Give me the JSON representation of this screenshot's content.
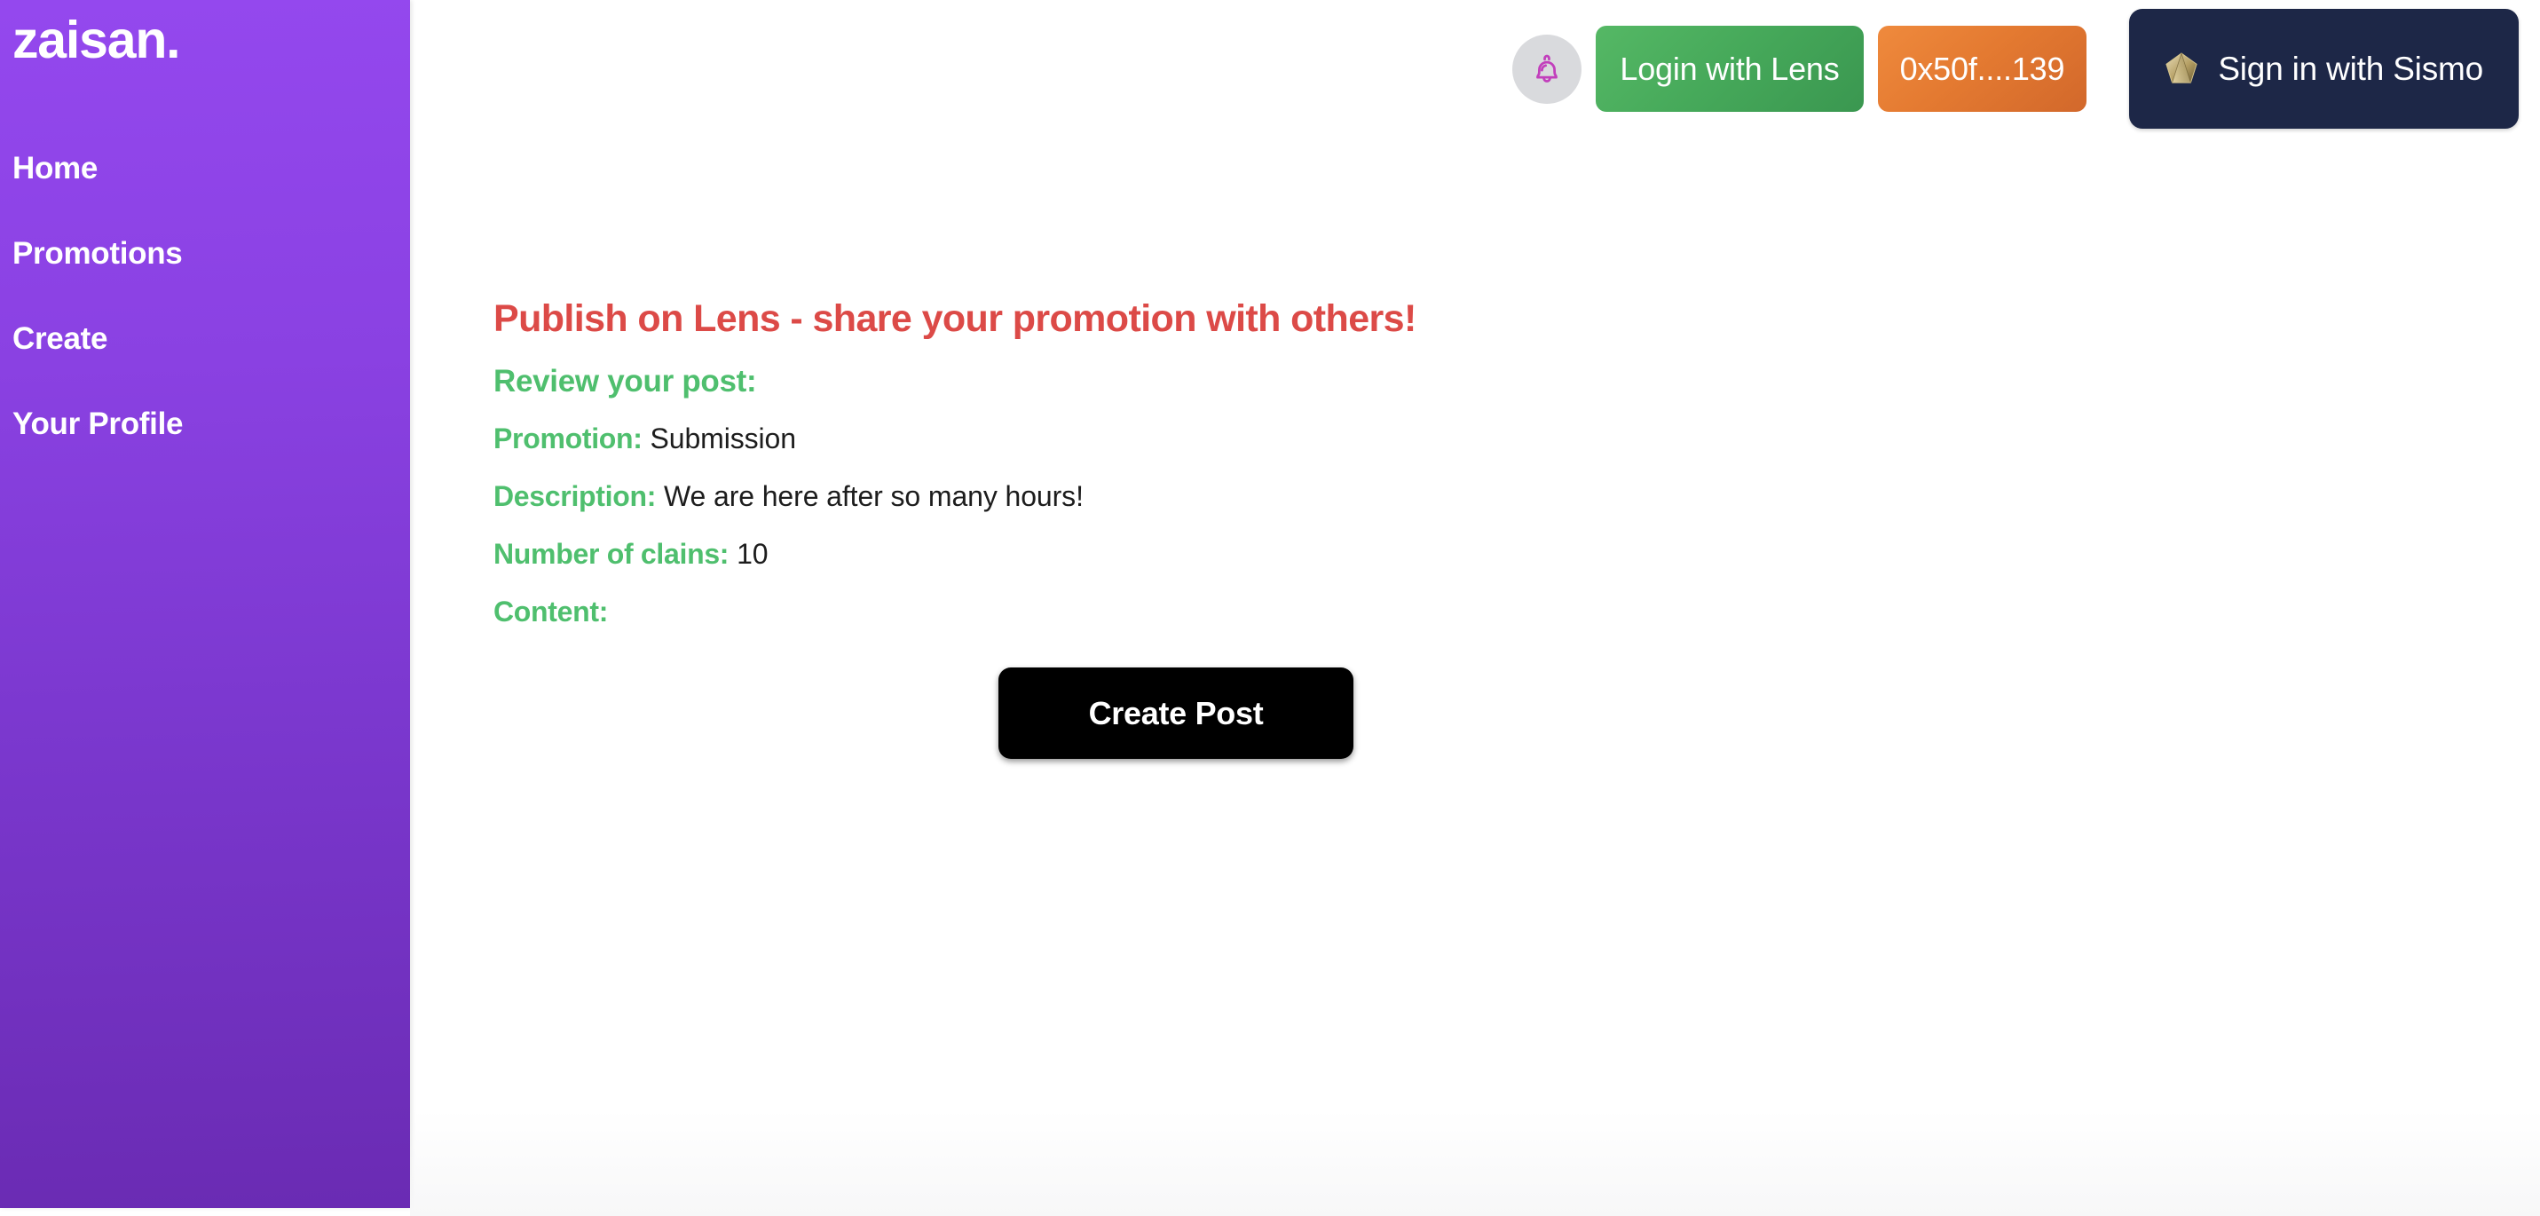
{
  "brand": {
    "name": "zaisan."
  },
  "sidebar": {
    "items": [
      {
        "label": "Home",
        "name": "home"
      },
      {
        "label": "Promotions",
        "name": "promotions"
      },
      {
        "label": "Create",
        "name": "create"
      },
      {
        "label": "Your Profile",
        "name": "your-profile"
      }
    ]
  },
  "header": {
    "notifications_icon": "bell-icon",
    "lens_button_label": "Login with Lens",
    "wallet_address_label": "0x50f....139",
    "sismo_button_label": "Sign in with Sismo",
    "sismo_icon": "sismo-pentagon-logo-icon"
  },
  "main": {
    "title": "Publish on Lens - share your promotion with others!",
    "subtitle": "Review your post:",
    "fields": [
      {
        "label": "Promotion:",
        "value": "Submission"
      },
      {
        "label": "Description:",
        "value": "We are here after so many hours!"
      },
      {
        "label": "Number of clains:",
        "value": "10"
      },
      {
        "label": "Content:",
        "value": ""
      }
    ],
    "create_post_label": "Create Post"
  },
  "colors": {
    "sidebar_top": "#9448ee",
    "sidebar_bottom": "#6a2bb3",
    "title_red": "#dc4a47",
    "label_green": "#4fbf6e",
    "lens_green": "#46a95a",
    "wallet_orange": "#e47a31",
    "sismo_navy": "#1d2747",
    "bell_purple": "#c23fbc",
    "bell_bg_gray": "#d9dadd",
    "cta_black": "#000000"
  }
}
